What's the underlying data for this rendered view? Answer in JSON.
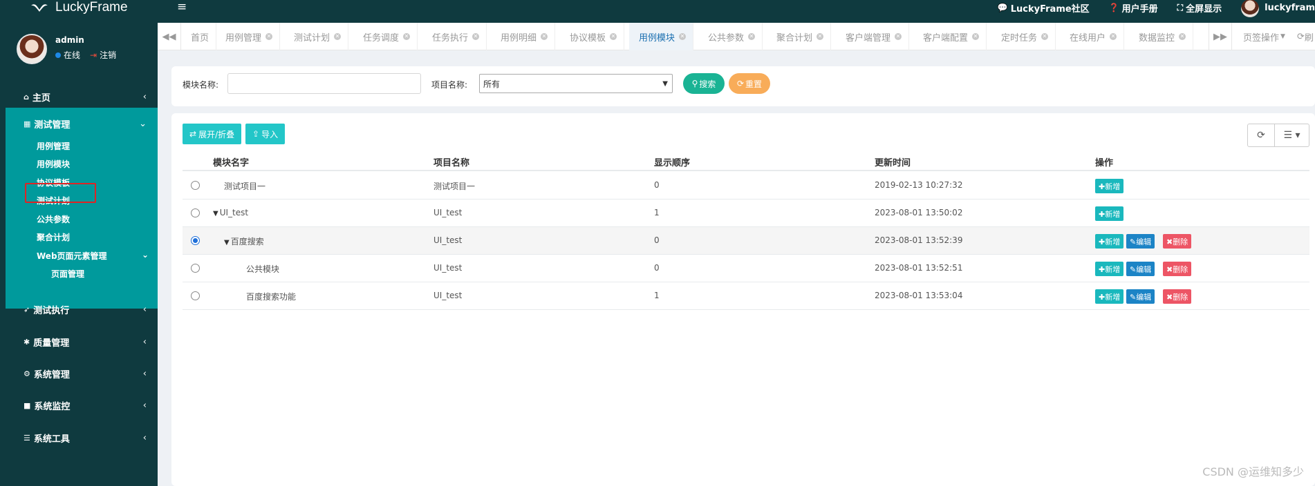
{
  "app": {
    "name": "LuckyFrame",
    "menu_icon": "≡"
  },
  "topbar": {
    "links": [
      {
        "icon": "comments-icon",
        "glyph": "💬",
        "label": "LuckyFrame社区"
      },
      {
        "icon": "question-icon",
        "glyph": "❓",
        "label": "用户手册"
      },
      {
        "icon": "fullscreen-icon",
        "glyph": "⛶",
        "label": "全屏显示"
      }
    ],
    "user_label": "luckyfram"
  },
  "user": {
    "name": "admin",
    "status": "在线",
    "logout": "注销"
  },
  "sidebar": {
    "home": "主页",
    "test_mgmt": "测试管理",
    "sub": [
      "用例管理",
      "用例模块",
      "协议模板",
      "测试计划",
      "公共参数",
      "聚合计划"
    ],
    "web_mgmt": "Web页面元素管理",
    "page_mgmt": "页面管理",
    "test_exec": "测试执行",
    "quality": "质量管理",
    "system": "系统管理",
    "monitor": "系统监控",
    "tools": "系统工具"
  },
  "tabs": [
    {
      "label": "首页",
      "closable": false
    },
    {
      "label": "用例管理",
      "closable": true
    },
    {
      "label": "测试计划",
      "closable": true
    },
    {
      "label": "任务调度",
      "closable": true
    },
    {
      "label": "任务执行",
      "closable": true
    },
    {
      "label": "用例明细",
      "closable": true
    },
    {
      "label": "协议模板",
      "closable": true
    },
    {
      "label": "用例模块",
      "closable": true,
      "active": true
    },
    {
      "label": "公共参数",
      "closable": true
    },
    {
      "label": "聚合计划",
      "closable": true
    },
    {
      "label": "客户端管理",
      "closable": true
    },
    {
      "label": "客户端配置",
      "closable": true
    },
    {
      "label": "定时任务",
      "closable": true
    },
    {
      "label": "在线用户",
      "closable": true
    },
    {
      "label": "数据监控",
      "closable": true
    }
  ],
  "tab_ops": {
    "page_ops": "页签操作",
    "refresh": "刷"
  },
  "search": {
    "module_label": "模块名称:",
    "module_value": "",
    "project_label": "项目名称:",
    "project_value": "所有",
    "search_btn": "搜索",
    "reset_btn": "重置"
  },
  "toolbar": {
    "expand_btn": "展开/折叠",
    "import_btn": "导入"
  },
  "table": {
    "headers": [
      "模块名字",
      "项目名称",
      "显示顺序",
      "更新时间",
      "操作"
    ],
    "rows": [
      {
        "name": "测试项目一",
        "project": "测试项目一",
        "order": "0",
        "updated": "2019-02-13 10:27:32",
        "checked": false,
        "indent": 0,
        "chevron": false,
        "actions": [
          "add"
        ]
      },
      {
        "name": "UI_test",
        "project": "UI_test",
        "order": "1",
        "updated": "2023-08-01 13:50:02",
        "checked": false,
        "indent": 0,
        "chevron": true,
        "actions": [
          "add"
        ]
      },
      {
        "name": "百度搜索",
        "project": "UI_test",
        "order": "0",
        "updated": "2023-08-01 13:52:39",
        "checked": true,
        "indent": 1,
        "chevron": true,
        "actions": [
          "add",
          "edit",
          "delete"
        ]
      },
      {
        "name": "公共模块",
        "project": "UI_test",
        "order": "0",
        "updated": "2023-08-01 13:52:51",
        "checked": false,
        "indent": 2,
        "chevron": false,
        "actions": [
          "add",
          "edit",
          "delete"
        ]
      },
      {
        "name": "百度搜索功能",
        "project": "UI_test",
        "order": "1",
        "updated": "2023-08-01 13:53:04",
        "checked": false,
        "indent": 2,
        "chevron": false,
        "actions": [
          "add",
          "edit",
          "delete"
        ]
      }
    ],
    "action_labels": {
      "add": "✚新增",
      "edit": "✎编辑",
      "delete": "✖删除"
    }
  },
  "watermark": "CSDN @运维知多少",
  "colors": {
    "sidebar_bg": "#0f3a3f",
    "sidebar_open": "#009a9c",
    "accent_green": "#1ab394",
    "accent_orange": "#f8ac59",
    "teal_btn": "#23c6c8",
    "edit_blue": "#1c84c6",
    "delete_red": "#ed5565",
    "highlight_red": "#e02424"
  }
}
